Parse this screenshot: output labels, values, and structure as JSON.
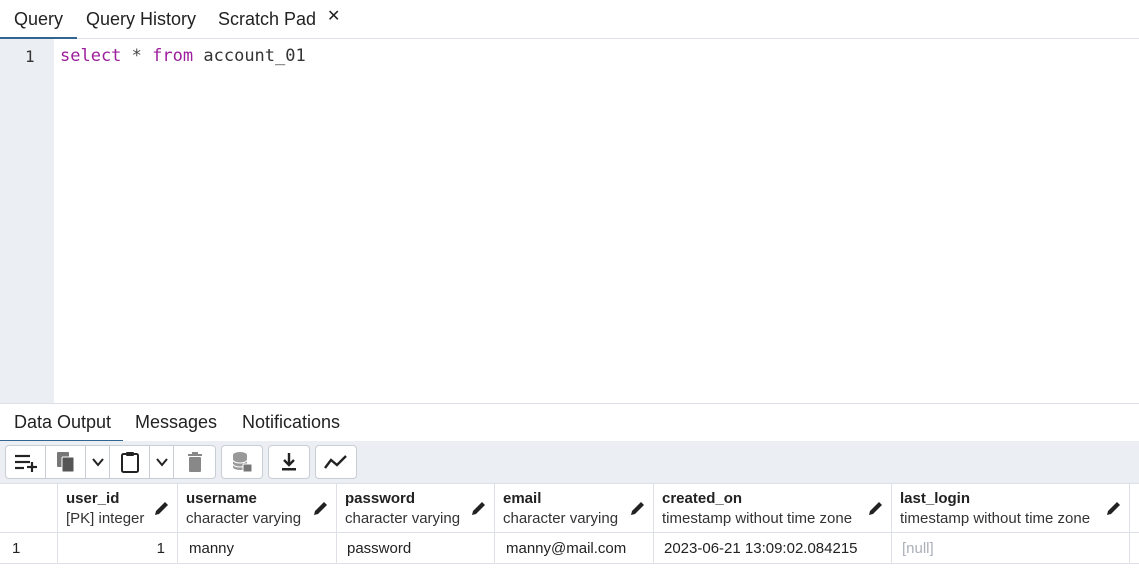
{
  "top_tabs": [
    {
      "label": "Query"
    },
    {
      "label": "Query History"
    },
    {
      "label": "Scratch Pad"
    }
  ],
  "editor": {
    "line_number": "1",
    "tokens": {
      "kw1": "select",
      "star": "*",
      "kw2": "from",
      "table": "account_01"
    }
  },
  "bottom_tabs": [
    {
      "label": "Data Output"
    },
    {
      "label": "Messages"
    },
    {
      "label": "Notifications"
    }
  ],
  "toolbar": {
    "icons": [
      "add-row-icon",
      "copy-icon",
      "chevron-down-icon",
      "paste-icon",
      "chevron-down-icon",
      "delete-icon",
      "save-data-icon",
      "download-icon",
      "graph-icon"
    ]
  },
  "grid": {
    "columns": [
      {
        "name": "user_id",
        "type": "[PK] integer"
      },
      {
        "name": "username",
        "type": "character varying"
      },
      {
        "name": "password",
        "type": "character varying"
      },
      {
        "name": "email",
        "type": "character varying"
      },
      {
        "name": "created_on",
        "type": "timestamp without time zone"
      },
      {
        "name": "last_login",
        "type": "timestamp without time zone"
      }
    ],
    "rows": [
      {
        "num": "1",
        "user_id": "1",
        "username": "manny",
        "password": "password",
        "email": "manny@mail.com",
        "created_on": "2023-06-21 13:09:02.084215",
        "last_login": "[null]"
      }
    ]
  },
  "colors": {
    "accent": "#326690",
    "keyword": "#9c1e9c",
    "gutter": "#ebeef3"
  }
}
